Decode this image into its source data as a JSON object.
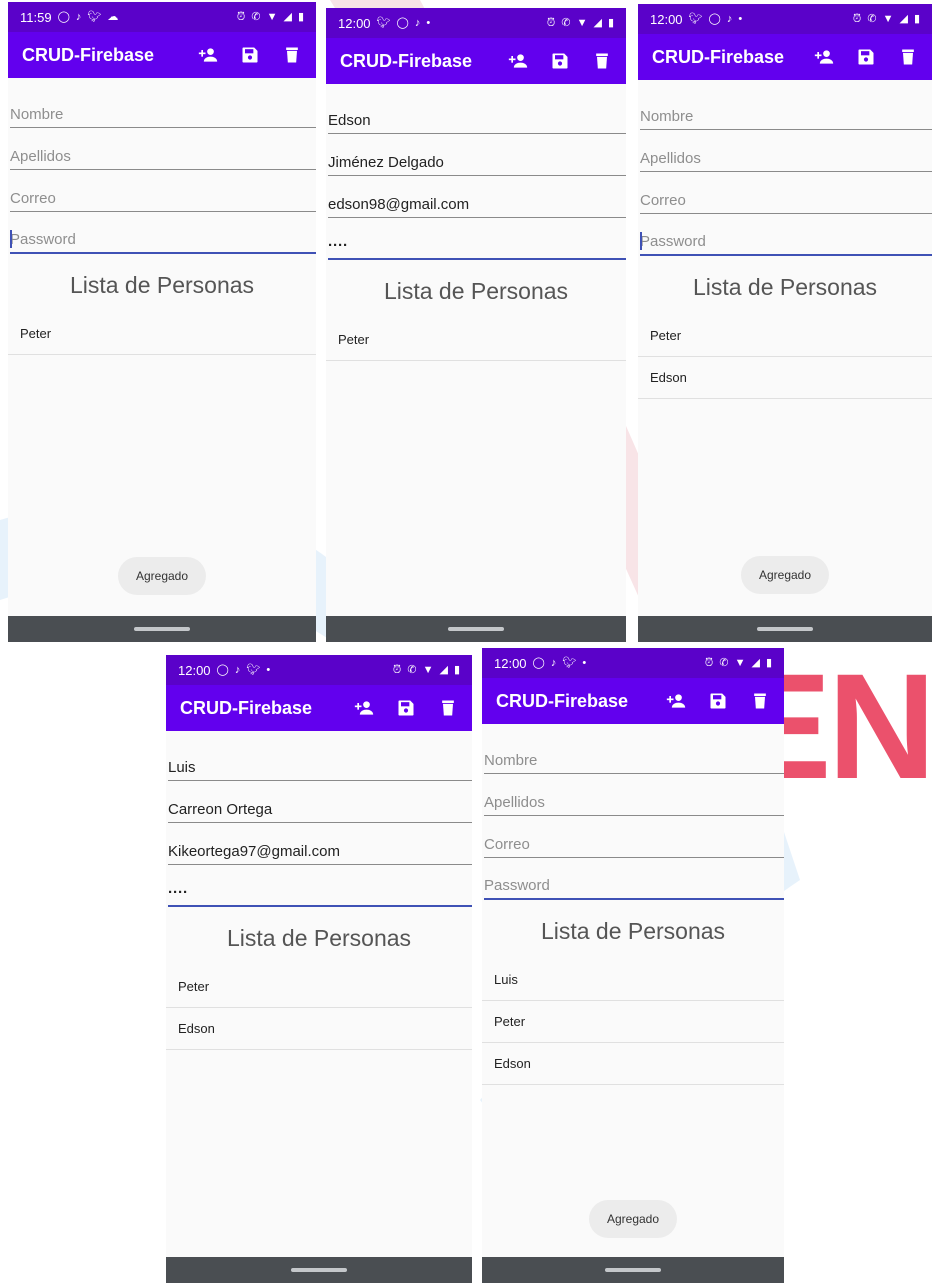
{
  "watermark": {
    "text": "DEN",
    "color": "#e5183c"
  },
  "colors": {
    "status_bar": "#5a02c9",
    "app_bar": "#6200ee",
    "focus": "#3f51b5",
    "nav_bar": "#4a4e52"
  },
  "common": {
    "app_title": "CRUD-Firebase",
    "list_title": "Lista de Personas",
    "placeholders": {
      "nombre": "Nombre",
      "apellidos": "Apellidos",
      "correo": "Correo",
      "password": "Password"
    },
    "actions": [
      "add-person-icon",
      "save-icon",
      "delete-icon"
    ]
  },
  "screens": [
    {
      "time": "11:59",
      "fields": {
        "nombre": "",
        "apellidos": "",
        "correo": "",
        "password": ""
      },
      "items": [
        "Peter"
      ],
      "toast": "Agregado"
    },
    {
      "time": "12:00",
      "fields": {
        "nombre": "Edson",
        "apellidos": "Jiménez Delgado",
        "correo": "edson98@gmail.com",
        "password": "····"
      },
      "items": [
        "Peter"
      ],
      "toast": ""
    },
    {
      "time": "12:00",
      "fields": {
        "nombre": "",
        "apellidos": "",
        "correo": "",
        "password": ""
      },
      "items": [
        "Peter",
        "Edson"
      ],
      "toast": "Agregado"
    },
    {
      "time": "12:00",
      "fields": {
        "nombre": "Luis",
        "apellidos": "Carreon Ortega",
        "correo": "Kikeortega97@gmail.com",
        "password": "····"
      },
      "items": [
        "Peter",
        "Edson"
      ],
      "toast": ""
    },
    {
      "time": "12:00",
      "fields": {
        "nombre": "",
        "apellidos": "",
        "correo": "",
        "password": ""
      },
      "items": [
        "Luis",
        "Peter",
        "Edson"
      ],
      "toast": "Agregado"
    }
  ]
}
